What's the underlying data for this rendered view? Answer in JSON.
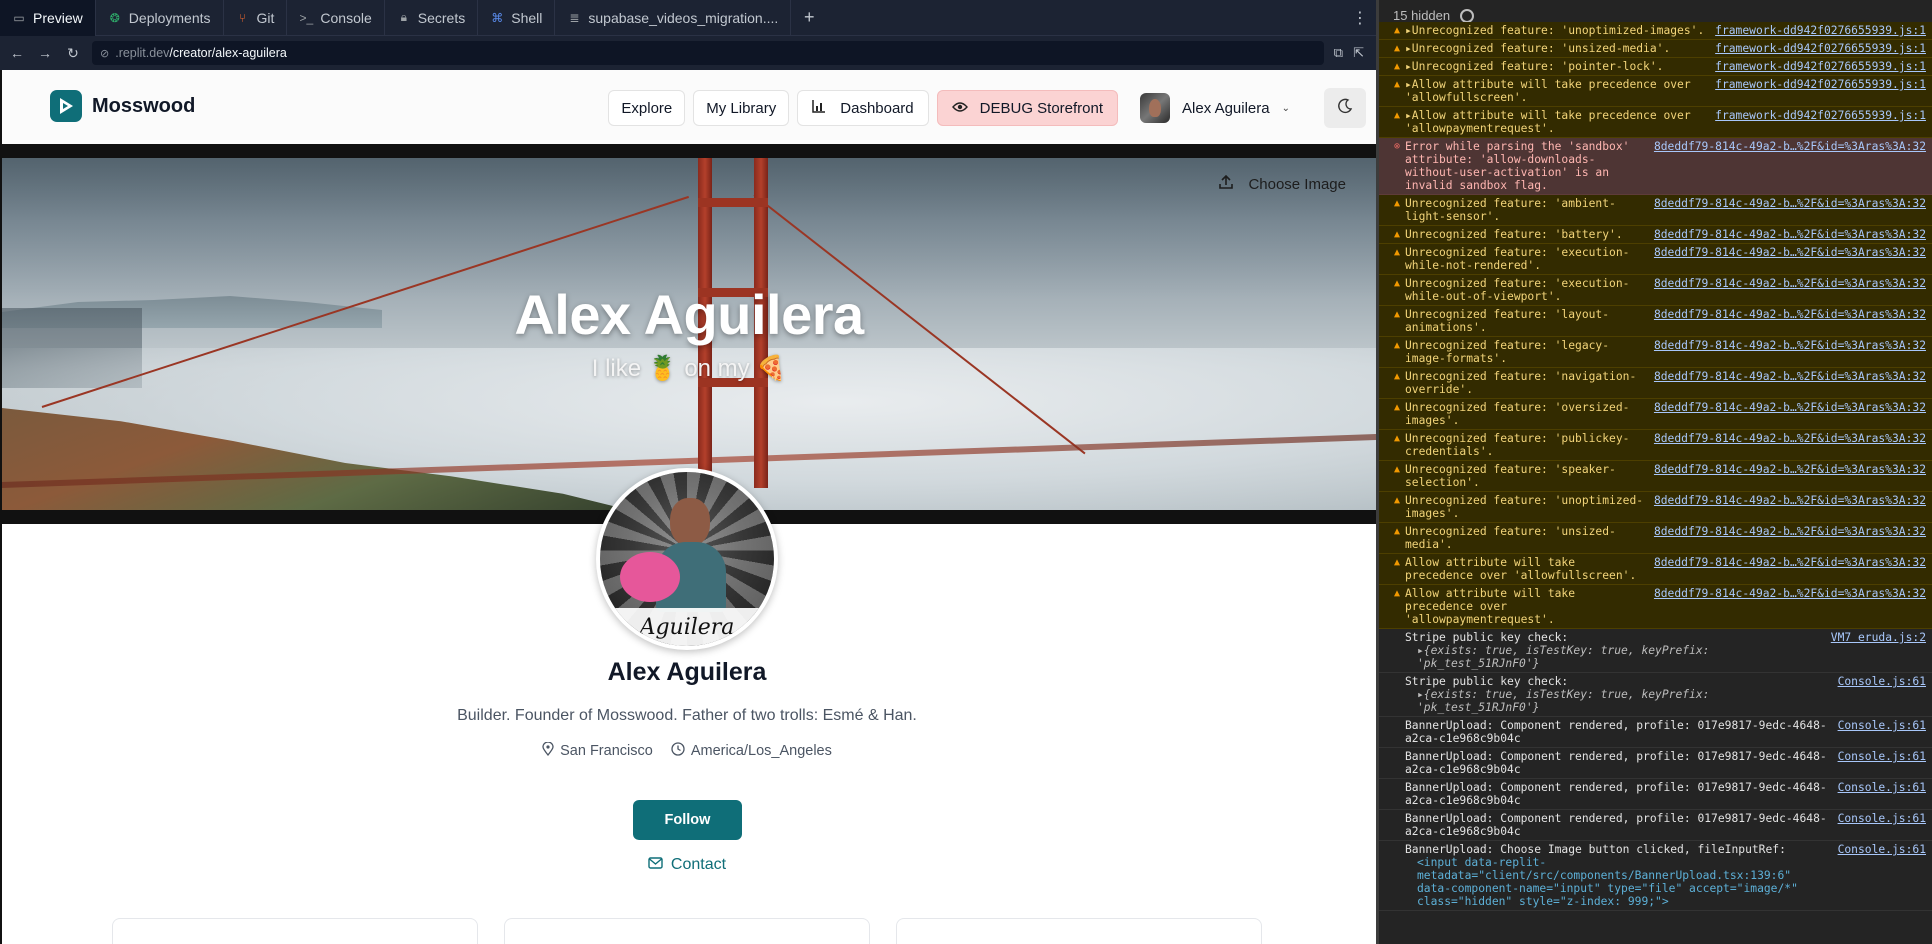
{
  "tabs": [
    {
      "label": "Preview",
      "icon": "preview-icon",
      "active": true
    },
    {
      "label": "Deployments",
      "icon": "deployments-icon"
    },
    {
      "label": "Git",
      "icon": "git-icon"
    },
    {
      "label": "Console",
      "icon": "console-icon"
    },
    {
      "label": "Secrets",
      "icon": "lock-icon"
    },
    {
      "label": "Shell",
      "icon": "shell-icon"
    },
    {
      "label": "supabase_videos_migration....",
      "icon": "file-icon"
    }
  ],
  "url": {
    "host": ".replit.dev",
    "path": "/creator/alex-aguilera"
  },
  "site": {
    "brand": "Mosswood",
    "nav": {
      "explore": "Explore",
      "library": "My Library",
      "dashboard": "Dashboard",
      "debug": "DEBUG Storefront",
      "user": "Alex Aguilera"
    }
  },
  "banner": {
    "title": "Alex Aguilera",
    "subtitle": "I like 🍍 on my 🍕",
    "choose_image": "Choose Image"
  },
  "profile": {
    "name": "Alex Aguilera",
    "bio": "Builder. Founder of Mosswood. Father of two trolls: Esmé & Han.",
    "location": "San Francisco",
    "timezone": "America/Los_Angeles",
    "follow": "Follow",
    "contact": "Contact",
    "signature": "Aguilera"
  },
  "console": {
    "hidden_count": "15 hidden",
    "logs": [
      {
        "level": "warn",
        "msg": "▸Unrecognized feature: 'unoptimized-images'.",
        "src": "framework-dd942f0276655939.js:1"
      },
      {
        "level": "warn",
        "msg": "▸Unrecognized feature: 'unsized-media'.",
        "src": "framework-dd942f0276655939.js:1"
      },
      {
        "level": "warn",
        "msg": "▸Unrecognized feature: 'pointer-lock'.",
        "src": "framework-dd942f0276655939.js:1"
      },
      {
        "level": "warn",
        "msg": "▸Allow attribute will take precedence over 'allowfullscreen'.",
        "src": "framework-dd942f0276655939.js:1"
      },
      {
        "level": "warn",
        "msg": "▸Allow attribute will take precedence over 'allowpaymentrequest'.",
        "src": "framework-dd942f0276655939.js:1"
      },
      {
        "level": "err",
        "msg": "Error while parsing the 'sandbox' attribute: 'allow-downloads-without-user-activation' is an invalid sandbox flag.",
        "src": "8deddf79-814c-49a2-b…%2F&id=%3Aras%3A:32"
      },
      {
        "level": "warn",
        "msg": "Unrecognized feature: 'ambient-light-sensor'.",
        "src": "8deddf79-814c-49a2-b…%2F&id=%3Aras%3A:32"
      },
      {
        "level": "warn",
        "msg": "Unrecognized feature: 'battery'.",
        "src": "8deddf79-814c-49a2-b…%2F&id=%3Aras%3A:32"
      },
      {
        "level": "warn",
        "msg": "Unrecognized feature: 'execution-while-not-rendered'.",
        "src": "8deddf79-814c-49a2-b…%2F&id=%3Aras%3A:32"
      },
      {
        "level": "warn",
        "msg": "Unrecognized feature: 'execution-while-out-of-viewport'.",
        "src": "8deddf79-814c-49a2-b…%2F&id=%3Aras%3A:32"
      },
      {
        "level": "warn",
        "msg": "Unrecognized feature: 'layout-animations'.",
        "src": "8deddf79-814c-49a2-b…%2F&id=%3Aras%3A:32"
      },
      {
        "level": "warn",
        "msg": "Unrecognized feature: 'legacy-image-formats'.",
        "src": "8deddf79-814c-49a2-b…%2F&id=%3Aras%3A:32"
      },
      {
        "level": "warn",
        "msg": "Unrecognized feature: 'navigation-override'.",
        "src": "8deddf79-814c-49a2-b…%2F&id=%3Aras%3A:32"
      },
      {
        "level": "warn",
        "msg": "Unrecognized feature: 'oversized-images'.",
        "src": "8deddf79-814c-49a2-b…%2F&id=%3Aras%3A:32"
      },
      {
        "level": "warn",
        "msg": "Unrecognized feature: 'publickey-credentials'.",
        "src": "8deddf79-814c-49a2-b…%2F&id=%3Aras%3A:32"
      },
      {
        "level": "warn",
        "msg": "Unrecognized feature: 'speaker-selection'.",
        "src": "8deddf79-814c-49a2-b…%2F&id=%3Aras%3A:32"
      },
      {
        "level": "warn",
        "msg": "Unrecognized feature: 'unoptimized-images'.",
        "src": "8deddf79-814c-49a2-b…%2F&id=%3Aras%3A:32"
      },
      {
        "level": "warn",
        "msg": "Unrecognized feature: 'unsized-media'.",
        "src": "8deddf79-814c-49a2-b…%2F&id=%3Aras%3A:32"
      },
      {
        "level": "warn",
        "msg": "Allow attribute will take precedence over 'allowfullscreen'.",
        "src": "8deddf79-814c-49a2-b…%2F&id=%3Aras%3A:32"
      },
      {
        "level": "warn",
        "msg": "Allow attribute will take precedence over 'allowpaymentrequest'.",
        "src": "8deddf79-814c-49a2-b…%2F&id=%3Aras%3A:32"
      },
      {
        "level": "log",
        "msg": "Stripe public key check:",
        "src": "VM7 eruda.js:2",
        "obj": "▸{exists: true, isTestKey: true, keyPrefix: 'pk_test_51RJnF0'}"
      },
      {
        "level": "log",
        "msg": "Stripe public key check:",
        "src": "Console.js:61",
        "obj": "▸{exists: true, isTestKey: true, keyPrefix: 'pk_test_51RJnF0'}"
      },
      {
        "level": "log",
        "msg": "BannerUpload: Component rendered, profile: 017e9817-9edc-4648-a2ca-c1e968c9b04c",
        "src": "Console.js:61"
      },
      {
        "level": "log",
        "msg": "BannerUpload: Component rendered, profile: 017e9817-9edc-4648-a2ca-c1e968c9b04c",
        "src": "Console.js:61"
      },
      {
        "level": "log",
        "msg": "BannerUpload: Component rendered, profile: 017e9817-9edc-4648-a2ca-c1e968c9b04c",
        "src": "Console.js:61"
      },
      {
        "level": "log",
        "msg": "BannerUpload: Component rendered, profile: 017e9817-9edc-4648-a2ca-c1e968c9b04c",
        "src": "Console.js:61"
      },
      {
        "level": "log",
        "msg": "BannerUpload: Choose Image button clicked, fileInputRef:",
        "src": "Console.js:61",
        "html": "<input data-replit-metadata=\"client/src/components/BannerUpload.tsx:139:6\" data-component-name=\"input\" type=\"file\" accept=\"image/*\" class=\"hidden\" style=\"z-index: 999;\">"
      }
    ]
  },
  "colors": {
    "brand": "#0f6e78",
    "debug_bg": "#fbd3d3",
    "warn_bg": "#332b00",
    "err_bg": "#4e3534"
  }
}
